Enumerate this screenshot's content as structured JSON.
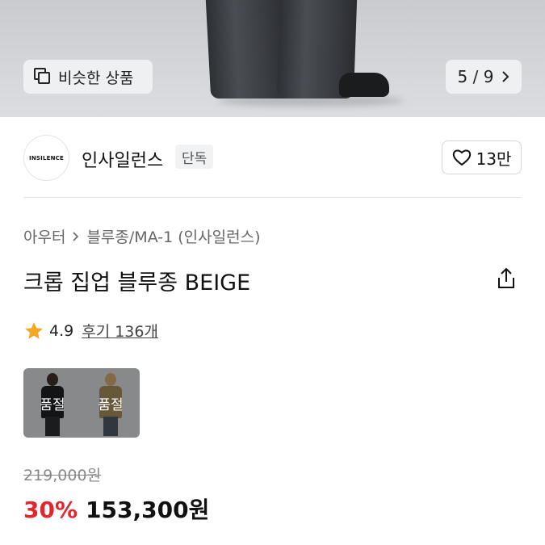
{
  "hero": {
    "similar_label": "비슷한 상품",
    "counter": "5 / 9"
  },
  "brand": {
    "logo_text": "INSILENCE",
    "name": "인사일런스",
    "badge": "단독",
    "likes": "13만"
  },
  "breadcrumb": {
    "category": "아우터",
    "subcategory": "블루종/MA-1 (인사일런스)"
  },
  "product": {
    "title": "크롭 집업 블루종 BEIGE",
    "rating": "4.9",
    "reviews": "후기 136개"
  },
  "options": [
    {
      "label": "품절",
      "color": "#1e1f22"
    },
    {
      "label": "품절",
      "color": "#a0875a"
    }
  ],
  "price": {
    "original": "219,000원",
    "discount": "30%",
    "sale": "153,300원"
  },
  "colors": {
    "discount": "#e3262b",
    "star": "#f5a623"
  }
}
